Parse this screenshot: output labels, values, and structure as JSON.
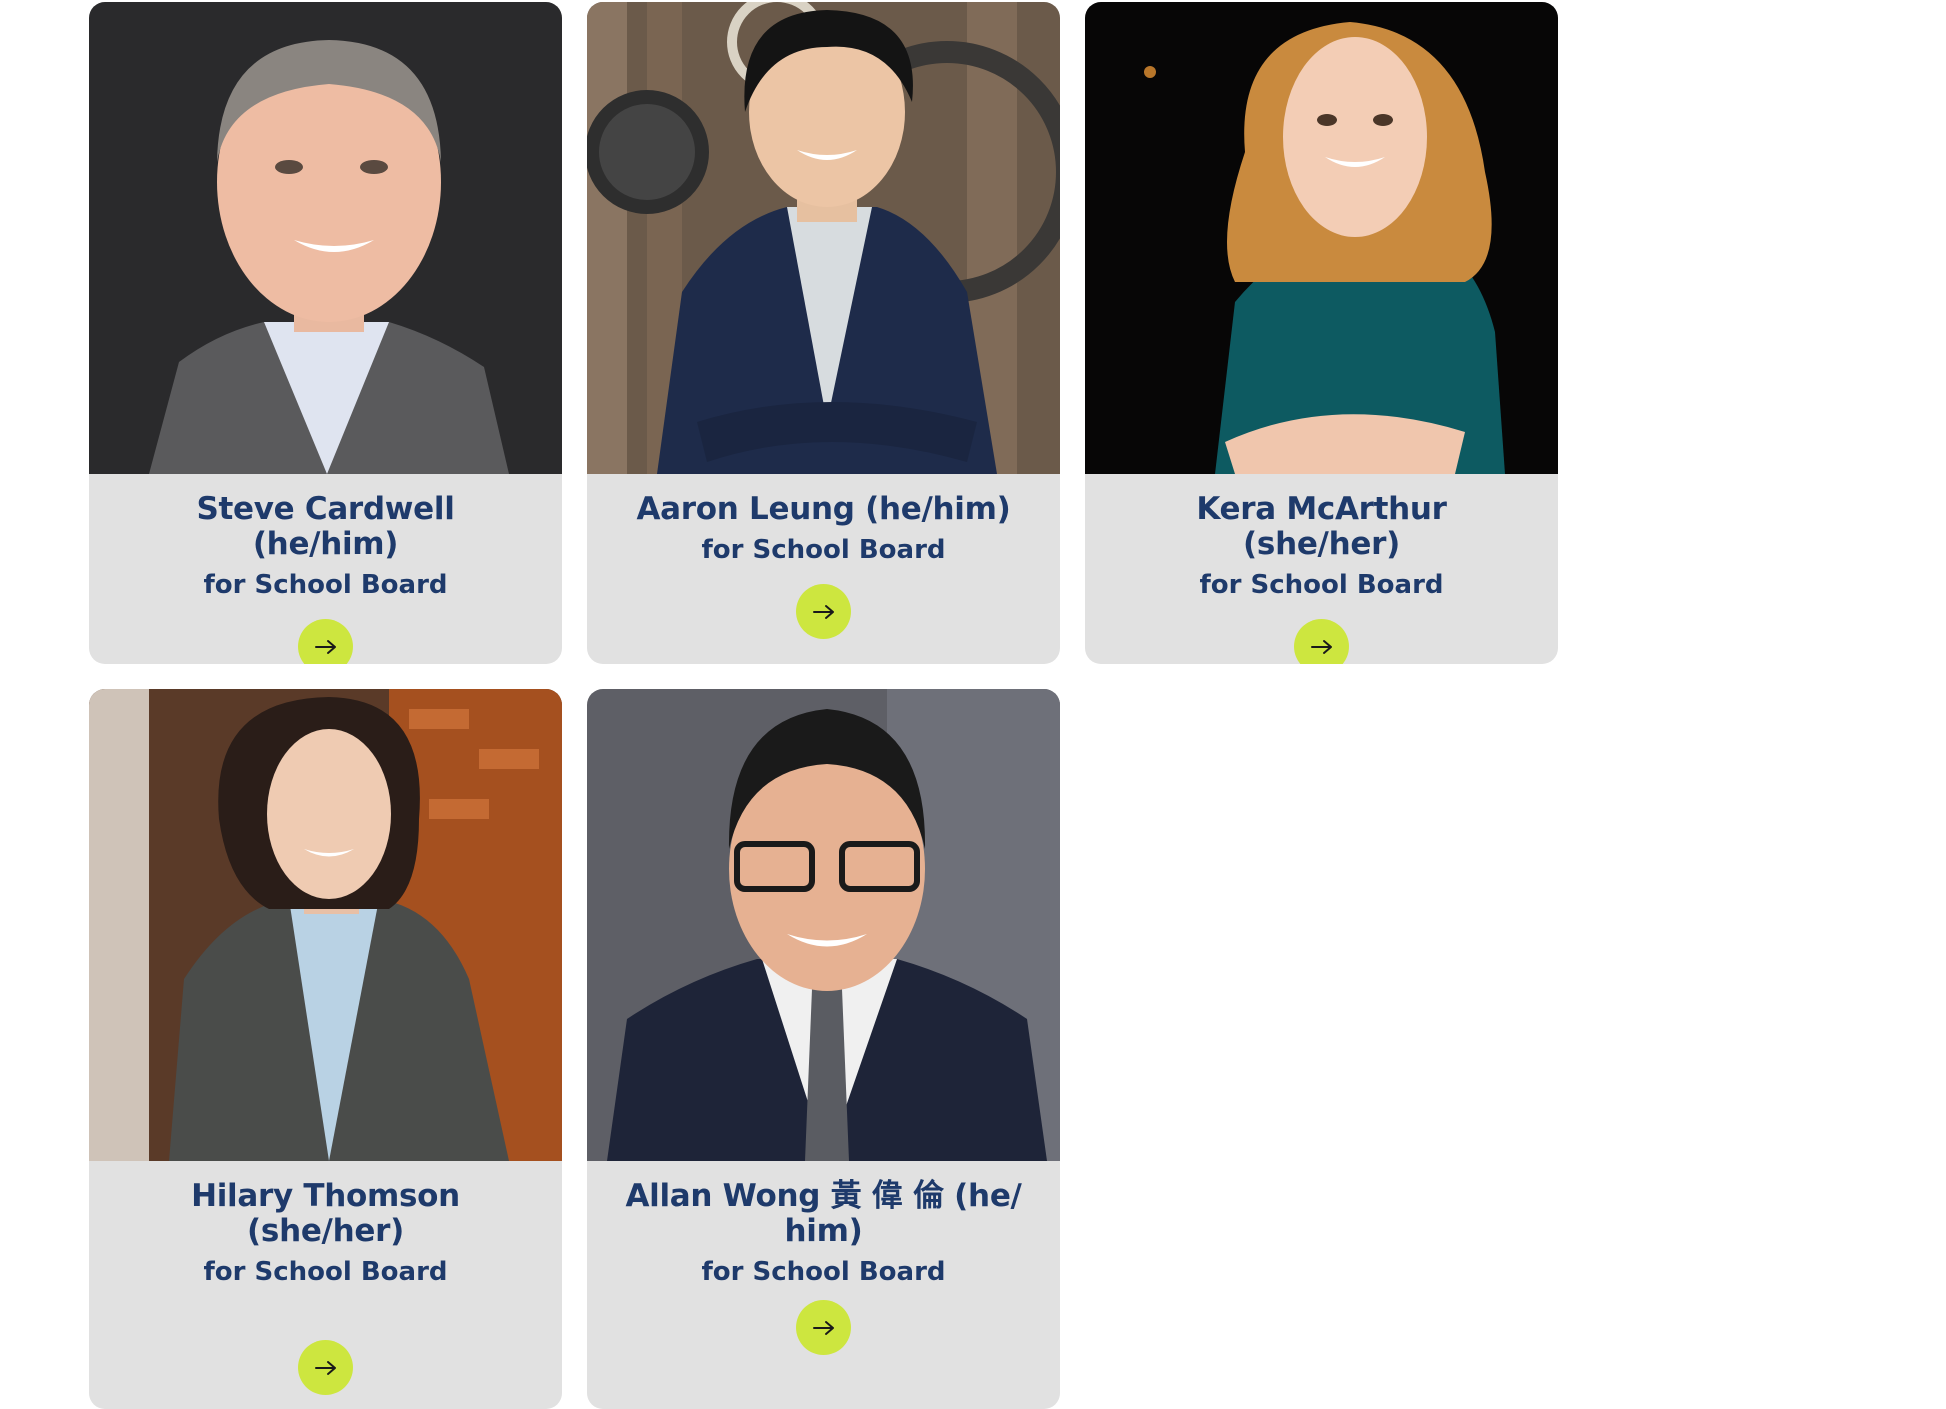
{
  "candidates": [
    {
      "name": "Steve Cardwell (he/him)",
      "role": "for School Board",
      "photo_alt": "Steve Cardwell"
    },
    {
      "name": "Aaron Leung (he/him)",
      "role": "for School Board",
      "photo_alt": "Aaron Leung"
    },
    {
      "name": "Kera McArthur (she/her)",
      "role": "for School Board",
      "photo_alt": "Kera McArthur"
    },
    {
      "name": "Hilary Thomson (she/her)",
      "role": "for School Board",
      "photo_alt": "Hilary Thomson"
    },
    {
      "name": "Allan Wong 黃 偉 倫 (he/ him)",
      "role": "for School Board",
      "photo_alt": "Allan Wong"
    }
  ],
  "icons": {
    "go": "arrow-right-icon"
  },
  "colors": {
    "card_bg": "#e1e1e1",
    "text": "#1e3a6b",
    "button": "#cde63f"
  }
}
